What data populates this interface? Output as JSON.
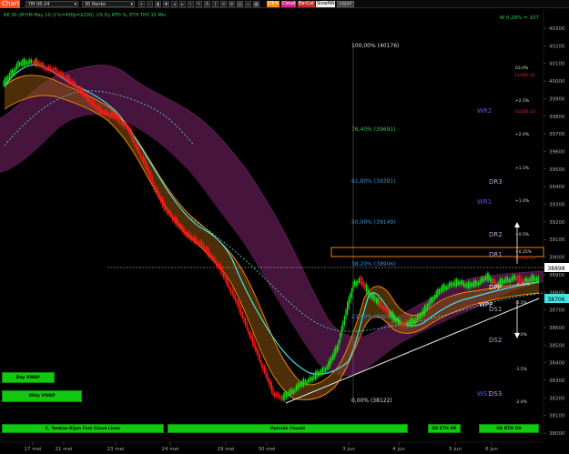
{
  "toolbar": {
    "chart_tab": "Chart",
    "symbol": "YM 06-24",
    "bartype": "30 Renko",
    "indicators": [
      {
        "label": "DTrA",
        "color": "#ff8c00"
      },
      {
        "label": "Cloud",
        "color": "#e0208a"
      },
      {
        "label": "BarCol",
        "color": "#c03030"
      },
      {
        "label": "SlowMA",
        "color": "#dddddd"
      },
      {
        "label": "VWAP",
        "color": "#cccccc"
      }
    ]
  },
  "header": {
    "info": "RE 30 (M)YM May 10 (1%=400p=$200), US Dy RTH %, ETH TPO 15 Min",
    "weekly": "W 0,28% = 107"
  },
  "price_axis": {
    "ticks": [
      "40300",
      "40200",
      "40100",
      "40000",
      "39900",
      "39800",
      "39700",
      "39600",
      "39500",
      "39400",
      "39300",
      "39200",
      "39100",
      "39000",
      "38900",
      "38800",
      "38700",
      "38600",
      "38500",
      "38400",
      "38300",
      "38200",
      "38100",
      "38000"
    ],
    "last_price": "38898",
    "cursor_price": "38706"
  },
  "time_axis": {
    "labels": [
      "17 mei",
      "21 mei",
      "23 mei",
      "24 mei",
      "29 mei",
      "30 mei",
      "3 jun",
      "4 jun",
      "5 jun",
      "6 jun"
    ]
  },
  "fib_levels": [
    {
      "label": "100,00% (40176)",
      "color": "#dddddd"
    },
    {
      "label": "76,40% (39691)",
      "color": "#3ac35a"
    },
    {
      "label": "61,80% (39391)",
      "color": "#3a8fd6"
    },
    {
      "label": "50,00% (39149)",
      "color": "#3a8fd6"
    },
    {
      "label": "38,20% (38906)",
      "color": "#3a8fd6"
    },
    {
      "label": "23,60% (38606)",
      "color": "#3a8fd6"
    },
    {
      "label": "0,00% (38122)",
      "color": "#dddddd"
    }
  ],
  "pivots": [
    {
      "label": "WR2",
      "color": "#5a5ad8"
    },
    {
      "label": "WR1",
      "color": "#5a5ad8"
    },
    {
      "label": "DR3",
      "color": "#c49ad8"
    },
    {
      "label": "DR2",
      "color": "#c49ad8"
    },
    {
      "label": "DR1",
      "color": "#c49ad8"
    },
    {
      "label": "DPP",
      "color": "#ffffff"
    },
    {
      "label": "WPP",
      "color": "#ffffff"
    },
    {
      "label": "DS1",
      "color": "#c49ad8"
    },
    {
      "label": "DS2",
      "color": "#c49ad8"
    },
    {
      "label": "WS1",
      "color": "#5a5ad8"
    },
    {
      "label": "DS3",
      "color": "#c49ad8"
    }
  ],
  "pct_levels": [
    {
      "label": "03.0%",
      "color": "#dddddd"
    },
    {
      "label": "CLOSE-21",
      "color": "#e03030"
    },
    {
      "label": "+2.5%",
      "color": "#dddddd"
    },
    {
      "label": "CLOSE-22",
      "color": "#e03030"
    },
    {
      "label": "+2.0%",
      "color": "#dddddd"
    },
    {
      "label": "+1.5%",
      "color": "#dddddd"
    },
    {
      "label": "+1.0%",
      "color": "#dddddd"
    },
    {
      "label": "+0.5%",
      "color": "#dddddd"
    },
    {
      "label": "+0.25%",
      "color": "#dddddd"
    },
    {
      "label": "CLOSE-23",
      "color": "#e03030"
    },
    {
      "label": "-0.25%",
      "color": "#dddddd"
    },
    {
      "label": "-0.5%",
      "color": "#dddddd"
    },
    {
      "label": "-1.0%",
      "color": "#dddddd"
    },
    {
      "label": "-1.5%",
      "color": "#dddddd"
    },
    {
      "label": "-2.0%",
      "color": "#dddddd"
    }
  ],
  "vwap_buttons": {
    "day": "Day VWAP",
    "wkly": "Wkly VWAP"
  },
  "session_bars": {
    "ichimoku": "C. Tenkan-Kijun Fast Cloud Lines",
    "outside": "Outside Clouds",
    "eth_1": "US ETH OR",
    "rth": "US RTH OR"
  },
  "colors": {
    "bull": "#15e415",
    "bear": "#ff1a1a",
    "cloud": "#5a1a48",
    "band_orange": "#ff8c00",
    "ma_cyan": "#3ee6e6",
    "fib_box": "#ff8c00"
  }
}
